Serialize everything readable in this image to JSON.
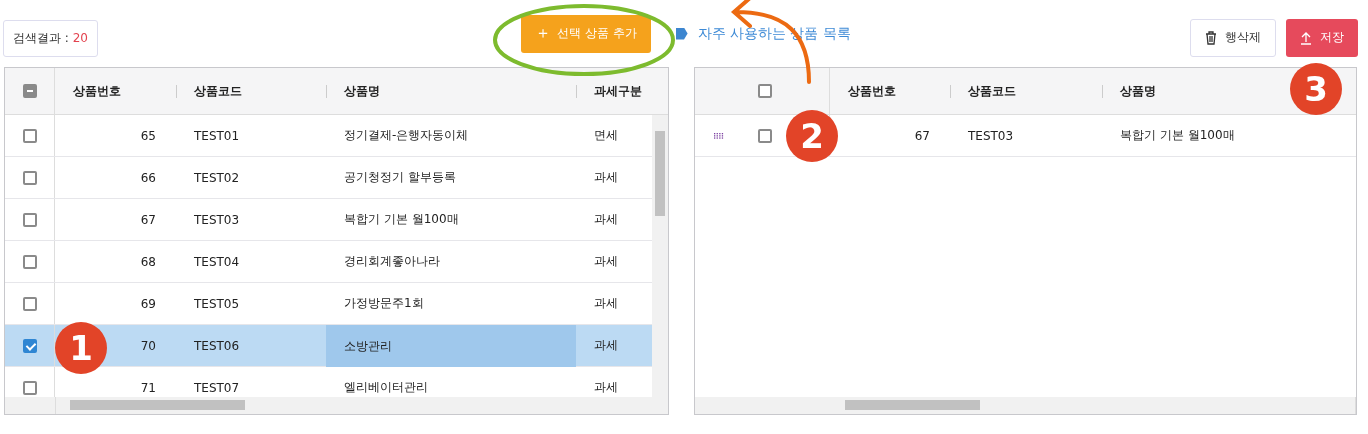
{
  "search_result": {
    "label": "검색결과 : ",
    "count": "20"
  },
  "add_button": {
    "icon": "＋",
    "label": "선택 상품 추가"
  },
  "favorites_link": {
    "label": "자주 사용하는 상품 목록"
  },
  "delete_button": {
    "label": "행삭제"
  },
  "save_button": {
    "label": "저장"
  },
  "left_grid": {
    "header_partial": true,
    "columns": [
      "상품번호",
      "상품코드",
      "상품명",
      "과세구분"
    ],
    "rows": [
      {
        "number": "65",
        "code": "TEST01",
        "name": "정기결제-은행자동이체",
        "tax": "면세",
        "checked": false,
        "selected": false
      },
      {
        "number": "66",
        "code": "TEST02",
        "name": "공기청정기 할부등록",
        "tax": "과세",
        "checked": false,
        "selected": false
      },
      {
        "number": "67",
        "code": "TEST03",
        "name": "복합기 기본 월100매",
        "tax": "과세",
        "checked": false,
        "selected": false
      },
      {
        "number": "68",
        "code": "TEST04",
        "name": "경리회계좋아나라",
        "tax": "과세",
        "checked": false,
        "selected": false
      },
      {
        "number": "69",
        "code": "TEST05",
        "name": "가정방문주1회",
        "tax": "과세",
        "checked": false,
        "selected": false
      },
      {
        "number": "70",
        "code": "TEST06",
        "name": "소방관리",
        "tax": "과세",
        "checked": true,
        "selected": true
      },
      {
        "number": "71",
        "code": "TEST07",
        "name": "엘리베이터관리",
        "tax": "과세",
        "checked": false,
        "selected": false
      }
    ]
  },
  "right_grid": {
    "header_partial": false,
    "columns": [
      "상품번호",
      "상품코드",
      "상품명"
    ],
    "rows": [
      {
        "number": "67",
        "code": "TEST03",
        "name": "복합기 기본 월100매",
        "checked": false
      }
    ]
  },
  "annotations": [
    {
      "label": "1"
    },
    {
      "label": "2"
    },
    {
      "label": "3"
    }
  ]
}
